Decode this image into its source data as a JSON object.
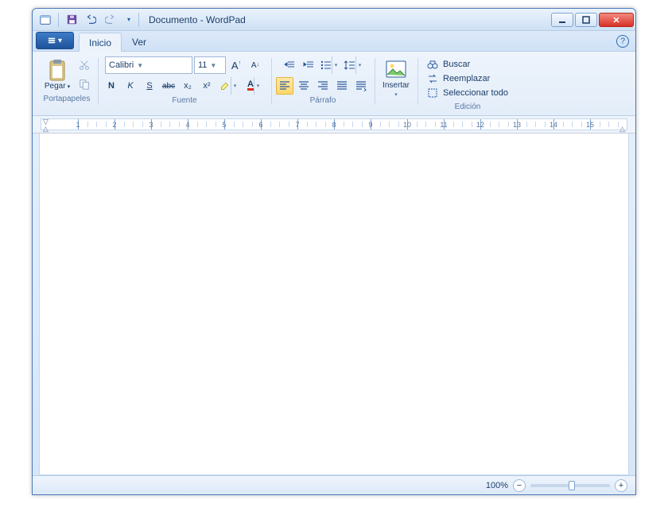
{
  "title": "Documento - WordPad",
  "tabs": {
    "inicio": "Inicio",
    "ver": "Ver"
  },
  "groups": {
    "clipboard": {
      "label": "Portapapeles",
      "paste": "Pegar"
    },
    "font": {
      "label": "Fuente",
      "family": "Calibri",
      "size": "11",
      "bold": "N",
      "italic": "K",
      "underline": "S",
      "strike": "abc",
      "sub": "x₂",
      "sup": "x²",
      "grow": "A",
      "shrink": "A"
    },
    "paragraph": {
      "label": "Párrafo"
    },
    "insert": {
      "label": "Insertar",
      "btn": "Insertar"
    },
    "editing": {
      "label": "Edición",
      "find": "Buscar",
      "replace": "Reemplazar",
      "selectall": "Seleccionar todo"
    }
  },
  "ruler": {
    "marks": [
      1,
      2,
      3,
      4,
      5,
      6,
      7,
      8,
      9,
      10,
      11,
      12,
      13,
      14,
      15
    ]
  },
  "status": {
    "zoom": "100%"
  }
}
